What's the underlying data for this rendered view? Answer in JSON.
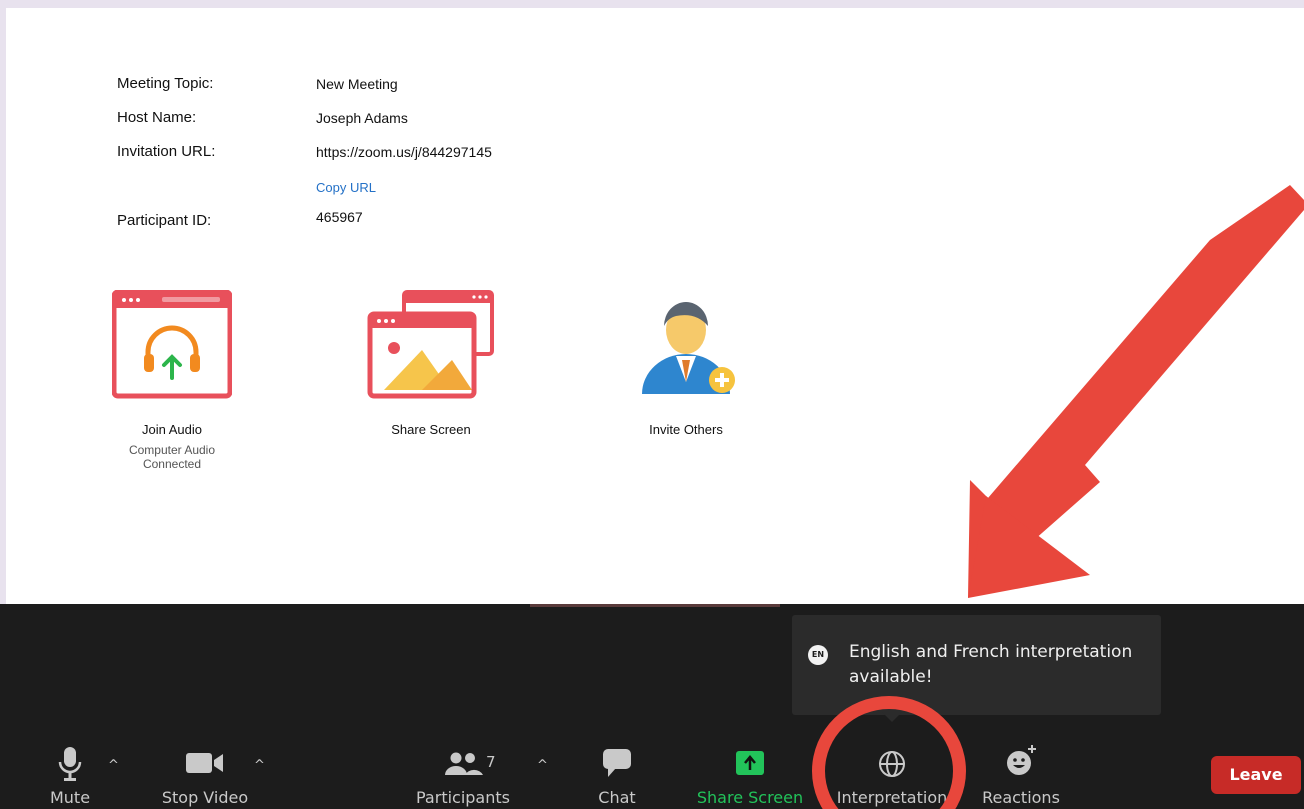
{
  "meeting_info": {
    "topic_label": "Meeting Topic:",
    "topic_value": "New Meeting",
    "host_label": "Host Name:",
    "host_value": "Joseph Adams",
    "url_label": "Invitation URL:",
    "url_value": "https://zoom.us/j/844297145",
    "copy_url": "Copy URL",
    "participant_label": "Participant ID:",
    "participant_value": "465967"
  },
  "actions": {
    "join_audio": "Join Audio",
    "join_audio_sub": "Computer Audio Connected",
    "share_screen": "Share Screen",
    "invite_others": "Invite Others"
  },
  "tooltip": {
    "badge": "EN",
    "text": "English and French interpretation available!"
  },
  "toolbar": {
    "mute": "Mute",
    "stop_video": "Stop Video",
    "participants": "Participants",
    "participants_count": "7",
    "chat": "Chat",
    "share_screen": "Share Screen",
    "interpretation": "Interpretation",
    "reactions": "Reactions",
    "leave": "Leave",
    "caret": "^"
  },
  "colors": {
    "toolbar_bg": "#1c1c1c",
    "share_green": "#22c35a",
    "leave_red": "#c72b27",
    "annotation_red": "#e8473c",
    "link_blue": "#2471c7"
  }
}
